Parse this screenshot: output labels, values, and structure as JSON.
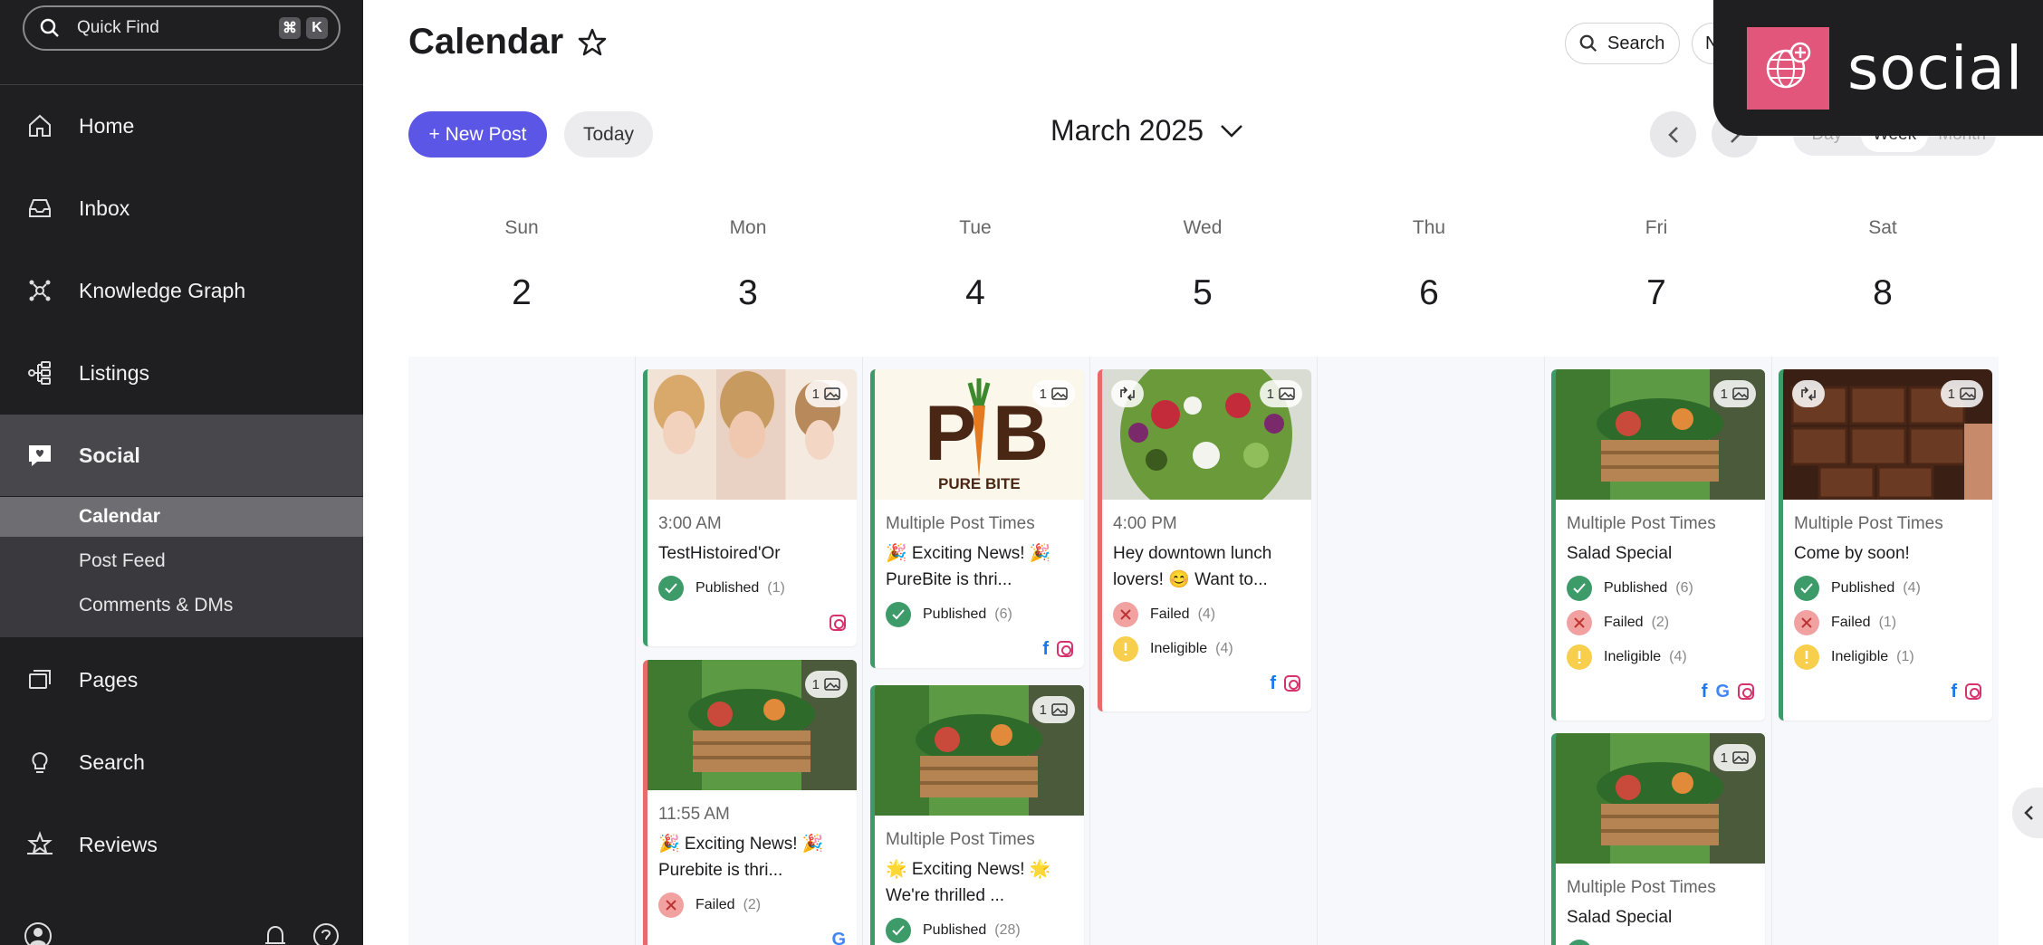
{
  "sidebar": {
    "quick_find": "Quick Find",
    "kbd": [
      "⌘",
      "K"
    ],
    "items": [
      {
        "label": "Home",
        "icon": "home-icon"
      },
      {
        "label": "Inbox",
        "icon": "inbox-icon"
      },
      {
        "label": "Knowledge Graph",
        "icon": "knowledge-graph-icon"
      },
      {
        "label": "Listings",
        "icon": "listings-icon"
      },
      {
        "label": "Social",
        "icon": "social-icon"
      },
      {
        "label": "Pages",
        "icon": "pages-icon"
      },
      {
        "label": "Search",
        "icon": "lightbulb-icon"
      },
      {
        "label": "Reviews",
        "icon": "reviews-icon"
      }
    ],
    "subitems": [
      "Calendar",
      "Post Feed",
      "Comments & DMs"
    ]
  },
  "header": {
    "title": "Calendar",
    "search": "Search",
    "n_label": "N",
    "new_post": "+ New Post",
    "today": "Today",
    "month": "March 2025",
    "views": [
      "Day",
      "Week",
      "Month"
    ]
  },
  "badge": {
    "text": "social",
    "color": "#e2567b"
  },
  "days": [
    {
      "name": "Sun",
      "num": "2"
    },
    {
      "name": "Mon",
      "num": "3"
    },
    {
      "name": "Tue",
      "num": "4"
    },
    {
      "name": "Wed",
      "num": "5"
    },
    {
      "name": "Thu",
      "num": "6"
    },
    {
      "name": "Fri",
      "num": "7"
    },
    {
      "name": "Sat",
      "num": "8"
    }
  ],
  "cards": {
    "mon1": {
      "count": "1",
      "time": "3:00 AM",
      "title": "TestHistoired'Or",
      "statuses": [
        {
          "label": "Published",
          "count": "(1)"
        }
      ]
    },
    "mon2": {
      "count": "1",
      "time": "11:55 AM",
      "title": "🎉 Exciting News! 🎉 Purebite is thri...",
      "statuses": [
        {
          "label": "Failed",
          "count": "(2)"
        }
      ]
    },
    "tue1": {
      "count": "1",
      "time": "Multiple Post Times",
      "title": "🎉 Exciting News! 🎉 PureBite is thri...",
      "statuses": [
        {
          "label": "Published",
          "count": "(6)"
        }
      ]
    },
    "tue2": {
      "count": "1",
      "time": "Multiple Post Times",
      "title": "🌟 Exciting News! 🌟 We're thrilled ...",
      "statuses": [
        {
          "label": "Published",
          "count": "(28)"
        }
      ]
    },
    "wed1": {
      "count": "1",
      "time": "4:00 PM",
      "title": "Hey downtown lunch lovers! 😊 Want to...",
      "statuses": [
        {
          "label": "Failed",
          "count": "(4)"
        },
        {
          "label": "Ineligible",
          "count": "(4)"
        }
      ]
    },
    "fri1": {
      "count": "1",
      "time": "Multiple Post Times",
      "title": "Salad Special",
      "statuses": [
        {
          "label": "Published",
          "count": "(6)"
        },
        {
          "label": "Failed",
          "count": "(2)"
        },
        {
          "label": "Ineligible",
          "count": "(4)"
        }
      ]
    },
    "fri2": {
      "count": "1",
      "time": "Multiple Post Times",
      "title": "Salad Special"
    },
    "sat1": {
      "count": "1",
      "time": "Multiple Post Times",
      "title": "Come by soon!",
      "statuses": [
        {
          "label": "Published",
          "count": "(4)"
        },
        {
          "label": "Failed",
          "count": "(1)"
        },
        {
          "label": "Ineligible",
          "count": "(1)"
        }
      ]
    }
  },
  "colors": {
    "accent": "#5b56e6",
    "published": "#3d9b6a",
    "failed": "#f2a1a1",
    "ineligible": "#f8cf4d"
  }
}
